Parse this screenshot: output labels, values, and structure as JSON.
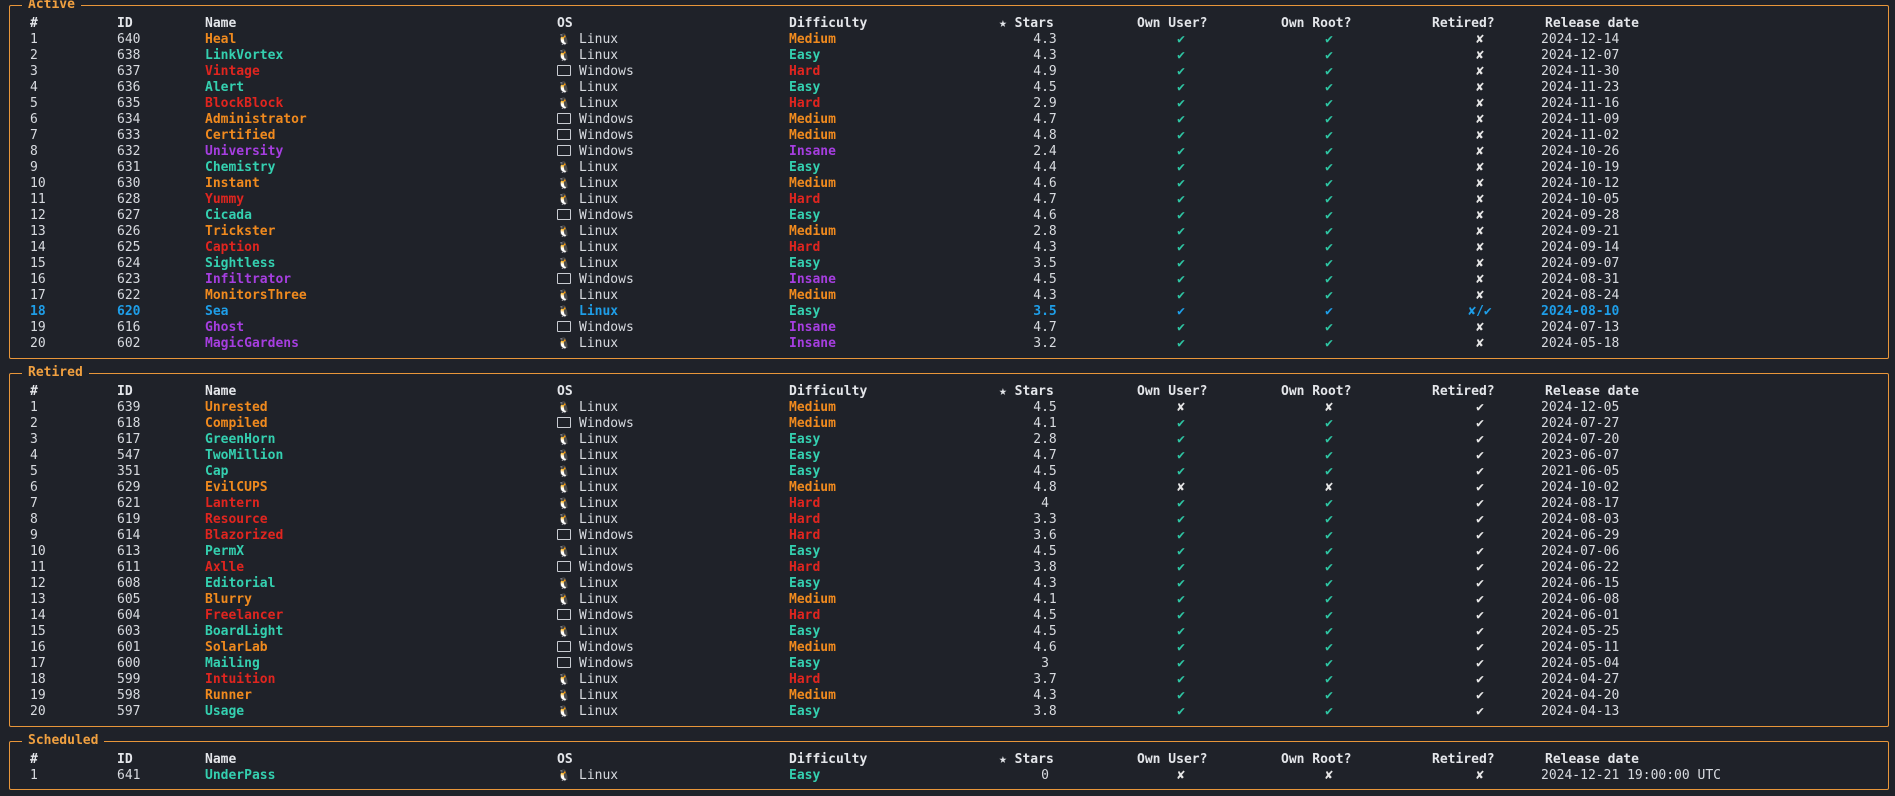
{
  "headers": {
    "num": "#",
    "id": "ID",
    "name": "Name",
    "os": "OS",
    "difficulty": "Difficulty",
    "stars": "★ Stars",
    "own_user": "Own User?",
    "own_root": "Own Root?",
    "retired": "Retired?",
    "release": "Release date"
  },
  "sections": [
    {
      "title": "Active",
      "rows": [
        {
          "num": "1",
          "id": "640",
          "name": "Heal",
          "os": "Linux",
          "difficulty": "Medium",
          "stars": "4.3",
          "user": "✔",
          "root": "✔",
          "retired": "✘",
          "date": "2024-12-14"
        },
        {
          "num": "2",
          "id": "638",
          "name": "LinkVortex",
          "os": "Linux",
          "difficulty": "Easy",
          "stars": "4.3",
          "user": "✔",
          "root": "✔",
          "retired": "✘",
          "date": "2024-12-07"
        },
        {
          "num": "3",
          "id": "637",
          "name": "Vintage",
          "os": "Windows",
          "difficulty": "Hard",
          "stars": "4.9",
          "user": "✔",
          "root": "✔",
          "retired": "✘",
          "date": "2024-11-30"
        },
        {
          "num": "4",
          "id": "636",
          "name": "Alert",
          "os": "Linux",
          "difficulty": "Easy",
          "stars": "4.5",
          "user": "✔",
          "root": "✔",
          "retired": "✘",
          "date": "2024-11-23"
        },
        {
          "num": "5",
          "id": "635",
          "name": "BlockBlock",
          "os": "Linux",
          "difficulty": "Hard",
          "stars": "2.9",
          "user": "✔",
          "root": "✔",
          "retired": "✘",
          "date": "2024-11-16"
        },
        {
          "num": "6",
          "id": "634",
          "name": "Administrator",
          "os": "Windows",
          "difficulty": "Medium",
          "stars": "4.7",
          "user": "✔",
          "root": "✔",
          "retired": "✘",
          "date": "2024-11-09"
        },
        {
          "num": "7",
          "id": "633",
          "name": "Certified",
          "os": "Windows",
          "difficulty": "Medium",
          "stars": "4.8",
          "user": "✔",
          "root": "✔",
          "retired": "✘",
          "date": "2024-11-02"
        },
        {
          "num": "8",
          "id": "632",
          "name": "University",
          "os": "Windows",
          "difficulty": "Insane",
          "stars": "2.4",
          "user": "✔",
          "root": "✔",
          "retired": "✘",
          "date": "2024-10-26"
        },
        {
          "num": "9",
          "id": "631",
          "name": "Chemistry",
          "os": "Linux",
          "difficulty": "Easy",
          "stars": "4.4",
          "user": "✔",
          "root": "✔",
          "retired": "✘",
          "date": "2024-10-19"
        },
        {
          "num": "10",
          "id": "630",
          "name": "Instant",
          "os": "Linux",
          "difficulty": "Medium",
          "stars": "4.6",
          "user": "✔",
          "root": "✔",
          "retired": "✘",
          "date": "2024-10-12"
        },
        {
          "num": "11",
          "id": "628",
          "name": "Yummy",
          "os": "Linux",
          "difficulty": "Hard",
          "stars": "4.7",
          "user": "✔",
          "root": "✔",
          "retired": "✘",
          "date": "2024-10-05"
        },
        {
          "num": "12",
          "id": "627",
          "name": "Cicada",
          "os": "Windows",
          "difficulty": "Easy",
          "stars": "4.6",
          "user": "✔",
          "root": "✔",
          "retired": "✘",
          "date": "2024-09-28"
        },
        {
          "num": "13",
          "id": "626",
          "name": "Trickster",
          "os": "Linux",
          "difficulty": "Medium",
          "stars": "2.8",
          "user": "✔",
          "root": "✔",
          "retired": "✘",
          "date": "2024-09-21"
        },
        {
          "num": "14",
          "id": "625",
          "name": "Caption",
          "os": "Linux",
          "difficulty": "Hard",
          "stars": "4.3",
          "user": "✔",
          "root": "✔",
          "retired": "✘",
          "date": "2024-09-14"
        },
        {
          "num": "15",
          "id": "624",
          "name": "Sightless",
          "os": "Linux",
          "difficulty": "Easy",
          "stars": "3.5",
          "user": "✔",
          "root": "✔",
          "retired": "✘",
          "date": "2024-09-07"
        },
        {
          "num": "16",
          "id": "623",
          "name": "Infiltrator",
          "os": "Windows",
          "difficulty": "Insane",
          "stars": "4.5",
          "user": "✔",
          "root": "✔",
          "retired": "✘",
          "date": "2024-08-31"
        },
        {
          "num": "17",
          "id": "622",
          "name": "MonitorsThree",
          "os": "Linux",
          "difficulty": "Medium",
          "stars": "4.3",
          "user": "✔",
          "root": "✔",
          "retired": "✘",
          "date": "2024-08-24"
        },
        {
          "num": "18",
          "id": "620",
          "name": "Sea",
          "os": "Linux",
          "difficulty": "Easy",
          "stars": "3.5",
          "user": "✔",
          "root": "✔",
          "retired": "✘/✔",
          "date": "2024-08-10",
          "highlight": true
        },
        {
          "num": "19",
          "id": "616",
          "name": "Ghost",
          "os": "Windows",
          "difficulty": "Insane",
          "stars": "4.7",
          "user": "✔",
          "root": "✔",
          "retired": "✘",
          "date": "2024-07-13"
        },
        {
          "num": "20",
          "id": "602",
          "name": "MagicGardens",
          "os": "Linux",
          "difficulty": "Insane",
          "stars": "3.2",
          "user": "✔",
          "root": "✔",
          "retired": "✘",
          "date": "2024-05-18"
        }
      ]
    },
    {
      "title": "Retired",
      "rows": [
        {
          "num": "1",
          "id": "639",
          "name": "Unrested",
          "os": "Linux",
          "difficulty": "Medium",
          "stars": "4.5",
          "user": "✘",
          "root": "✘",
          "retired": "✔",
          "date": "2024-12-05"
        },
        {
          "num": "2",
          "id": "618",
          "name": "Compiled",
          "os": "Windows",
          "difficulty": "Medium",
          "stars": "4.1",
          "user": "✔",
          "root": "✔",
          "retired": "✔",
          "date": "2024-07-27"
        },
        {
          "num": "3",
          "id": "617",
          "name": "GreenHorn",
          "os": "Linux",
          "difficulty": "Easy",
          "stars": "2.8",
          "user": "✔",
          "root": "✔",
          "retired": "✔",
          "date": "2024-07-20"
        },
        {
          "num": "4",
          "id": "547",
          "name": "TwoMillion",
          "os": "Linux",
          "difficulty": "Easy",
          "stars": "4.7",
          "user": "✔",
          "root": "✔",
          "retired": "✔",
          "date": "2023-06-07"
        },
        {
          "num": "5",
          "id": "351",
          "name": "Cap",
          "os": "Linux",
          "difficulty": "Easy",
          "stars": "4.5",
          "user": "✔",
          "root": "✔",
          "retired": "✔",
          "date": "2021-06-05"
        },
        {
          "num": "6",
          "id": "629",
          "name": "EvilCUPS",
          "os": "Linux",
          "difficulty": "Medium",
          "stars": "4.8",
          "user": "✘",
          "root": "✘",
          "retired": "✔",
          "date": "2024-10-02"
        },
        {
          "num": "7",
          "id": "621",
          "name": "Lantern",
          "os": "Linux",
          "difficulty": "Hard",
          "stars": "4",
          "user": "✔",
          "root": "✔",
          "retired": "✔",
          "date": "2024-08-17"
        },
        {
          "num": "8",
          "id": "619",
          "name": "Resource",
          "os": "Linux",
          "difficulty": "Hard",
          "stars": "3.3",
          "user": "✔",
          "root": "✔",
          "retired": "✔",
          "date": "2024-08-03"
        },
        {
          "num": "9",
          "id": "614",
          "name": "Blazorized",
          "os": "Windows",
          "difficulty": "Hard",
          "stars": "3.6",
          "user": "✔",
          "root": "✔",
          "retired": "✔",
          "date": "2024-06-29"
        },
        {
          "num": "10",
          "id": "613",
          "name": "PermX",
          "os": "Linux",
          "difficulty": "Easy",
          "stars": "4.5",
          "user": "✔",
          "root": "✔",
          "retired": "✔",
          "date": "2024-07-06"
        },
        {
          "num": "11",
          "id": "611",
          "name": "Axlle",
          "os": "Windows",
          "difficulty": "Hard",
          "stars": "3.8",
          "user": "✔",
          "root": "✔",
          "retired": "✔",
          "date": "2024-06-22"
        },
        {
          "num": "12",
          "id": "608",
          "name": "Editorial",
          "os": "Linux",
          "difficulty": "Easy",
          "stars": "4.3",
          "user": "✔",
          "root": "✔",
          "retired": "✔",
          "date": "2024-06-15"
        },
        {
          "num": "13",
          "id": "605",
          "name": "Blurry",
          "os": "Linux",
          "difficulty": "Medium",
          "stars": "4.1",
          "user": "✔",
          "root": "✔",
          "retired": "✔",
          "date": "2024-06-08"
        },
        {
          "num": "14",
          "id": "604",
          "name": "Freelancer",
          "os": "Windows",
          "difficulty": "Hard",
          "stars": "4.5",
          "user": "✔",
          "root": "✔",
          "retired": "✔",
          "date": "2024-06-01"
        },
        {
          "num": "15",
          "id": "603",
          "name": "BoardLight",
          "os": "Linux",
          "difficulty": "Easy",
          "stars": "4.5",
          "user": "✔",
          "root": "✔",
          "retired": "✔",
          "date": "2024-05-25"
        },
        {
          "num": "16",
          "id": "601",
          "name": "SolarLab",
          "os": "Windows",
          "difficulty": "Medium",
          "stars": "4.6",
          "user": "✔",
          "root": "✔",
          "retired": "✔",
          "date": "2024-05-11"
        },
        {
          "num": "17",
          "id": "600",
          "name": "Mailing",
          "os": "Windows",
          "difficulty": "Easy",
          "stars": "3",
          "user": "✔",
          "root": "✔",
          "retired": "✔",
          "date": "2024-05-04"
        },
        {
          "num": "18",
          "id": "599",
          "name": "Intuition",
          "os": "Linux",
          "difficulty": "Hard",
          "stars": "3.7",
          "user": "✔",
          "root": "✔",
          "retired": "✔",
          "date": "2024-04-27"
        },
        {
          "num": "19",
          "id": "598",
          "name": "Runner",
          "os": "Linux",
          "difficulty": "Medium",
          "stars": "4.3",
          "user": "✔",
          "root": "✔",
          "retired": "✔",
          "date": "2024-04-20"
        },
        {
          "num": "20",
          "id": "597",
          "name": "Usage",
          "os": "Linux",
          "difficulty": "Easy",
          "stars": "3.8",
          "user": "✔",
          "root": "✔",
          "retired": "✔",
          "date": "2024-04-13"
        }
      ]
    },
    {
      "title": "Scheduled",
      "rows": [
        {
          "num": "1",
          "id": "641",
          "name": "UnderPass",
          "os": "Linux",
          "difficulty": "Easy",
          "stars": "0",
          "user": "✘",
          "root": "✘",
          "retired": "✘",
          "date": "2024-12-21 19:00:00 UTC"
        }
      ]
    }
  ],
  "colors": {
    "border": "#e8963a",
    "easy": "#34d0b0",
    "medium": "#f08a1e",
    "hard": "#e0251f",
    "insane": "#a63ee0",
    "highlight": "#1e9ee8",
    "check": "#2ec4a2"
  },
  "icons": {
    "linux": "penguin-icon",
    "windows": "window-icon"
  }
}
